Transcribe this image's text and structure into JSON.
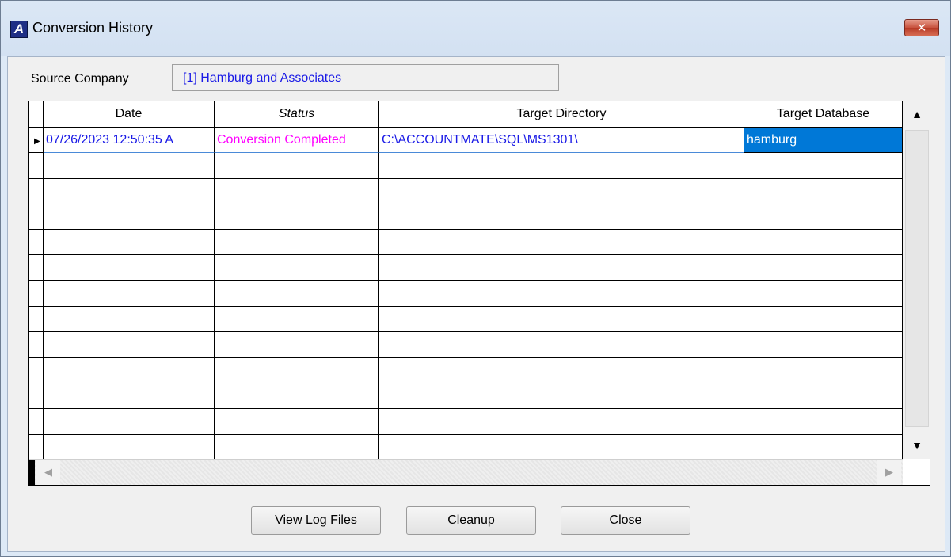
{
  "window": {
    "title": "Conversion History",
    "app_icon_letter": "A",
    "close_glyph": "✕"
  },
  "source_company": {
    "label": "Source Company",
    "value": "[1] Hamburg and Associates"
  },
  "grid": {
    "columns": [
      "Date",
      "Status",
      "Target Directory",
      "Target Database"
    ],
    "rows": [
      {
        "date": "07/26/2023 12:50:35 A",
        "status": "Conversion Completed",
        "target_directory": "C:\\ACCOUNTMATE\\SQL\\MS1301\\",
        "target_database": "hamburg"
      }
    ],
    "row_pointer_glyph": "▶",
    "scroll_up_glyph": "▲",
    "scroll_down_glyph": "▼",
    "scroll_left_glyph": "◀",
    "scroll_right_glyph": "▶"
  },
  "buttons": {
    "view_log_files": {
      "pre": "",
      "mnemonic": "V",
      "post": "iew Log Files"
    },
    "cleanup": {
      "pre": "Cleanu",
      "mnemonic": "p",
      "post": ""
    },
    "close": {
      "pre": "",
      "mnemonic": "C",
      "post": "lose"
    }
  },
  "colors": {
    "link_blue": "#1a1ae6",
    "status_magenta": "#ff00ff",
    "selection_blue": "#0078d7"
  }
}
